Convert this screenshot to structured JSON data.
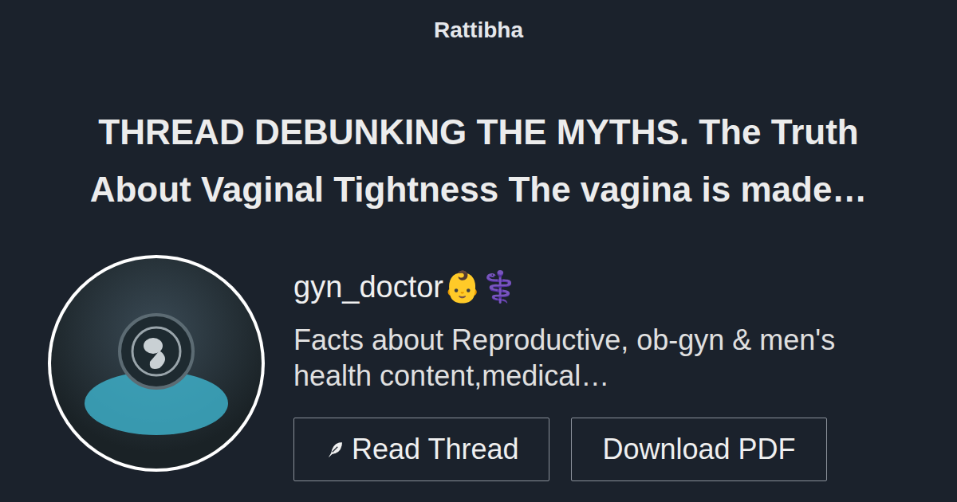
{
  "site": {
    "name": "Rattibha"
  },
  "title": "THREAD DEBUNKING THE MYTHS. The Truth About Vaginal Tightness The vagina is made…",
  "profile": {
    "username": "gyn_doctor👶⚕️",
    "bio": "Facts about Reproductive, ob-gyn & men's health content,medical…"
  },
  "buttons": [
    {
      "label": "Read Thread",
      "kind": "feather"
    },
    {
      "label": "Download PDF",
      "kind": "plain"
    }
  ]
}
